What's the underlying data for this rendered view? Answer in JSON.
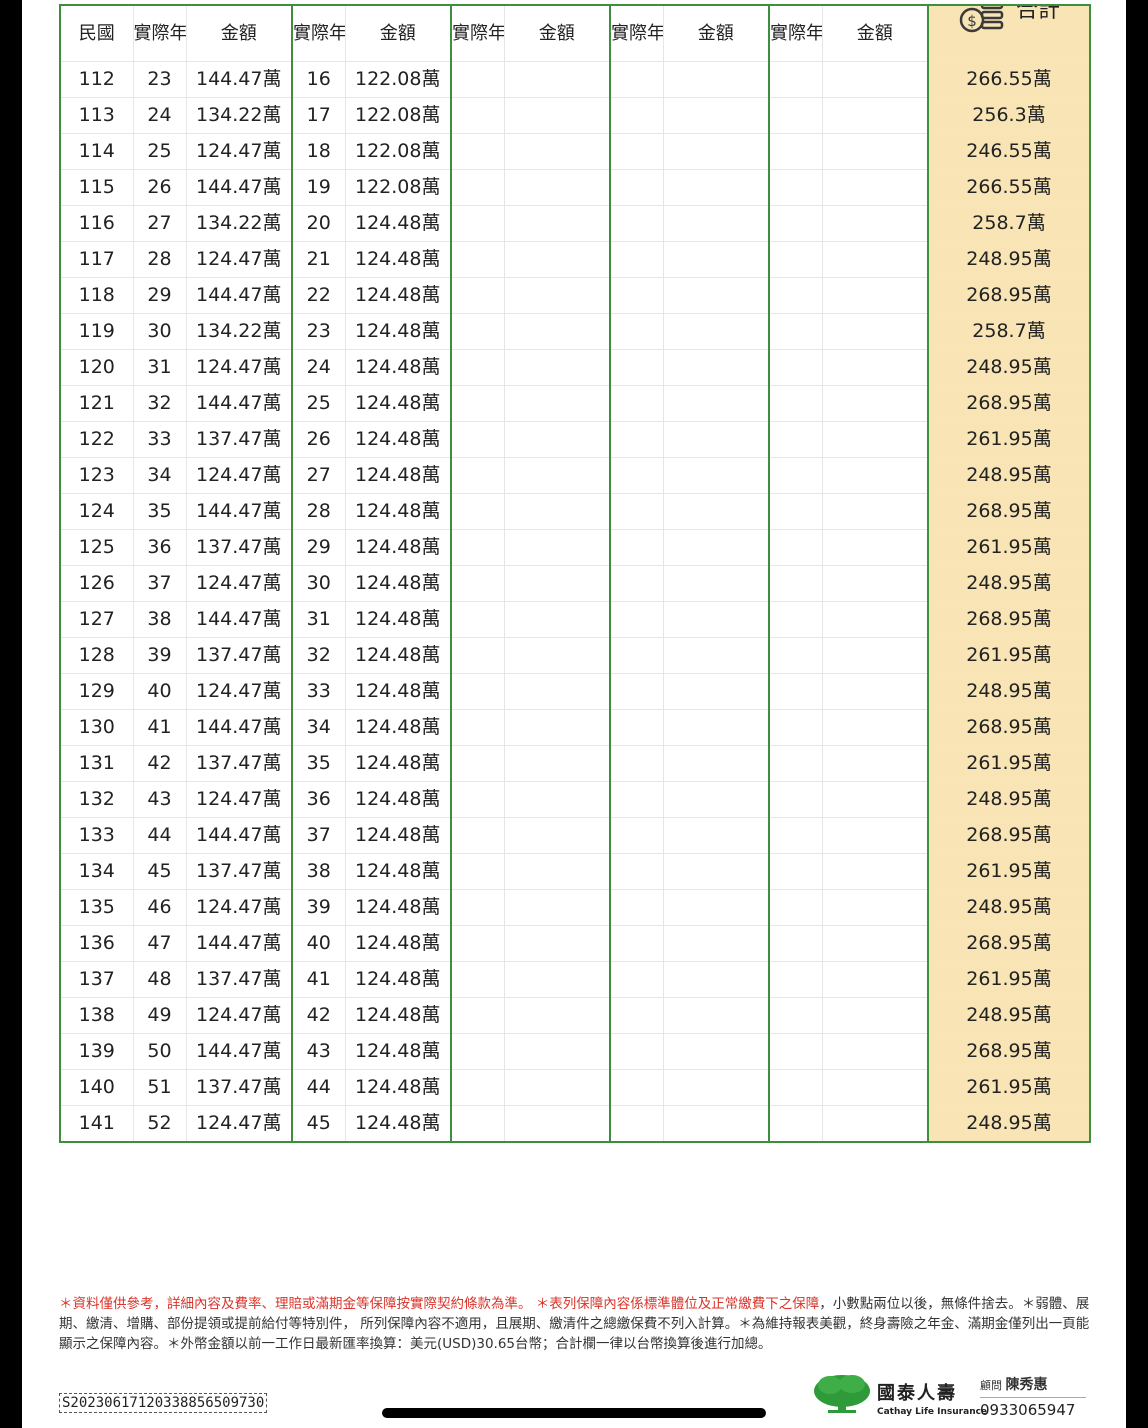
{
  "headers": {
    "year": "民國",
    "age": "實際年齡",
    "amount": "金額",
    "total": "合計"
  },
  "rows": [
    [
      "112",
      "23",
      "144.47萬",
      "16",
      "122.08萬",
      "266.55萬"
    ],
    [
      "113",
      "24",
      "134.22萬",
      "17",
      "122.08萬",
      "256.3萬"
    ],
    [
      "114",
      "25",
      "124.47萬",
      "18",
      "122.08萬",
      "246.55萬"
    ],
    [
      "115",
      "26",
      "144.47萬",
      "19",
      "122.08萬",
      "266.55萬"
    ],
    [
      "116",
      "27",
      "134.22萬",
      "20",
      "124.48萬",
      "258.7萬"
    ],
    [
      "117",
      "28",
      "124.47萬",
      "21",
      "124.48萬",
      "248.95萬"
    ],
    [
      "118",
      "29",
      "144.47萬",
      "22",
      "124.48萬",
      "268.95萬"
    ],
    [
      "119",
      "30",
      "134.22萬",
      "23",
      "124.48萬",
      "258.7萬"
    ],
    [
      "120",
      "31",
      "124.47萬",
      "24",
      "124.48萬",
      "248.95萬"
    ],
    [
      "121",
      "32",
      "144.47萬",
      "25",
      "124.48萬",
      "268.95萬"
    ],
    [
      "122",
      "33",
      "137.47萬",
      "26",
      "124.48萬",
      "261.95萬"
    ],
    [
      "123",
      "34",
      "124.47萬",
      "27",
      "124.48萬",
      "248.95萬"
    ],
    [
      "124",
      "35",
      "144.47萬",
      "28",
      "124.48萬",
      "268.95萬"
    ],
    [
      "125",
      "36",
      "137.47萬",
      "29",
      "124.48萬",
      "261.95萬"
    ],
    [
      "126",
      "37",
      "124.47萬",
      "30",
      "124.48萬",
      "248.95萬"
    ],
    [
      "127",
      "38",
      "144.47萬",
      "31",
      "124.48萬",
      "268.95萬"
    ],
    [
      "128",
      "39",
      "137.47萬",
      "32",
      "124.48萬",
      "261.95萬"
    ],
    [
      "129",
      "40",
      "124.47萬",
      "33",
      "124.48萬",
      "248.95萬"
    ],
    [
      "130",
      "41",
      "144.47萬",
      "34",
      "124.48萬",
      "268.95萬"
    ],
    [
      "131",
      "42",
      "137.47萬",
      "35",
      "124.48萬",
      "261.95萬"
    ],
    [
      "132",
      "43",
      "124.47萬",
      "36",
      "124.48萬",
      "248.95萬"
    ],
    [
      "133",
      "44",
      "144.47萬",
      "37",
      "124.48萬",
      "268.95萬"
    ],
    [
      "134",
      "45",
      "137.47萬",
      "38",
      "124.48萬",
      "261.95萬"
    ],
    [
      "135",
      "46",
      "124.47萬",
      "39",
      "124.48萬",
      "248.95萬"
    ],
    [
      "136",
      "47",
      "144.47萬",
      "40",
      "124.48萬",
      "268.95萬"
    ],
    [
      "137",
      "48",
      "137.47萬",
      "41",
      "124.48萬",
      "261.95萬"
    ],
    [
      "138",
      "49",
      "124.47萬",
      "42",
      "124.48萬",
      "248.95萬"
    ],
    [
      "139",
      "50",
      "144.47萬",
      "43",
      "124.48萬",
      "268.95萬"
    ],
    [
      "140",
      "51",
      "137.47萬",
      "44",
      "124.48萬",
      "261.95萬"
    ],
    [
      "141",
      "52",
      "124.47萬",
      "45",
      "124.48萬",
      "248.95萬"
    ]
  ],
  "footnote": {
    "red_1": "＊資料僅供參考，詳細內容及費率、理賠或滿期金等保障按實際契約條款為準。",
    "red_2": "＊表列保障內容係標準體位及正常繳費下之保障",
    "rest": "，小數點兩位以後，無條件捨去。＊弱體、展期、繳清、增購、部份提領或提前給付等特別件， 所列保障內容不適用，且展期、繳清件之總繳保費不列入計算。＊為維持報表美觀，終身壽險之年金、滿期金僅列出一頁能顯示之保障內容。＊外幣金額以前一工作日最新匯率換算：美元(USD)30.65台幣；合計欄一律以台幣換算後進行加總。"
  },
  "serial": "S20230617120338856509730",
  "brand": {
    "zh": "國泰人壽",
    "en": "Cathay Life Insurance"
  },
  "advisor": {
    "label": "顧問",
    "name": "陳秀惠",
    "phone": "0933065947"
  },
  "colors": {
    "border_green": "#3c8f3c",
    "total_bg": "#f8e4b5",
    "note_red": "#d9342b"
  },
  "icons": [
    "coin-stack-icon",
    "cathay-tree-logo"
  ]
}
